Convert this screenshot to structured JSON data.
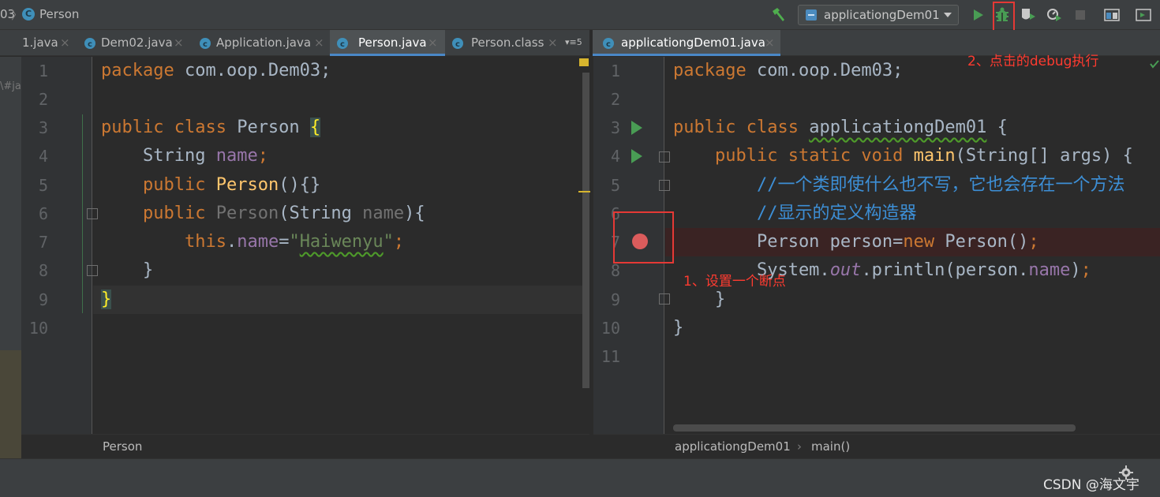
{
  "navbar": {
    "crumb_module": "03",
    "crumb_sep": "〉",
    "crumb_class_icon": "C",
    "crumb_file": "Person",
    "run_config": "applicationgDem01",
    "toolbar_icons": [
      "hammer-icon",
      "run-icon",
      "debug-icon",
      "coverage-icon",
      "profile-icon",
      "stop-icon",
      "project-structure-icon",
      "terminal-icon"
    ]
  },
  "left_tabs": [
    {
      "label": "1.java",
      "close": "×"
    },
    {
      "label": "Dem02.java",
      "close": "×"
    },
    {
      "label": "Application.java",
      "close": "×"
    },
    {
      "label": "Person.java",
      "close": "×"
    },
    {
      "label": "Person.class",
      "close": "×"
    }
  ],
  "left_tab_overflow": "▾≡5",
  "right_tabs": [
    {
      "label": "applicationgDem01.java",
      "close": "×"
    }
  ],
  "left_editor": {
    "line_numbers": [
      "1",
      "2",
      "3",
      "4",
      "5",
      "6",
      "7",
      "8",
      "9",
      "10"
    ]
  },
  "right_editor": {
    "line_numbers": [
      "1",
      "2",
      "3",
      "4",
      "5",
      "6",
      "7",
      "8",
      "9",
      "10",
      "11"
    ]
  },
  "left_crumb": "Person",
  "right_crumb": {
    "cls": "applicationgDem01",
    "sep": "›",
    "method": "main()"
  },
  "left_stripe_text": "\\#ja",
  "annotations": {
    "debug_note": "2、点击的debug执行",
    "breakpoint_note": "1、设置一个断点"
  },
  "watermark": "CSDN @海文宇",
  "colors": {
    "accent_tab": "#4a88c7",
    "annotation": "#ff3b30",
    "breakpoint": "#db5c5c",
    "run_green": "#499c54"
  }
}
